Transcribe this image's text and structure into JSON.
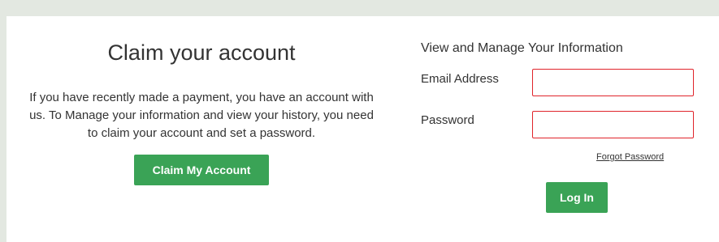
{
  "claim": {
    "title": "Claim your account",
    "description": "If you have recently made a payment, you have an account with us. To Manage your information and view your history, you need to claim your account and set a password.",
    "button_label": "Claim My Account"
  },
  "login": {
    "title": "View and Manage Your Information",
    "email_label": "Email Address",
    "email_value": "",
    "password_label": "Password",
    "password_value": "",
    "forgot_password_label": "Forgot Password",
    "login_button_label": "Log In"
  },
  "colors": {
    "page_background": "#e3e8e1",
    "panel_background": "#ffffff",
    "button_green": "#3aa356",
    "input_error_border": "#e0242b",
    "text": "#333333"
  }
}
